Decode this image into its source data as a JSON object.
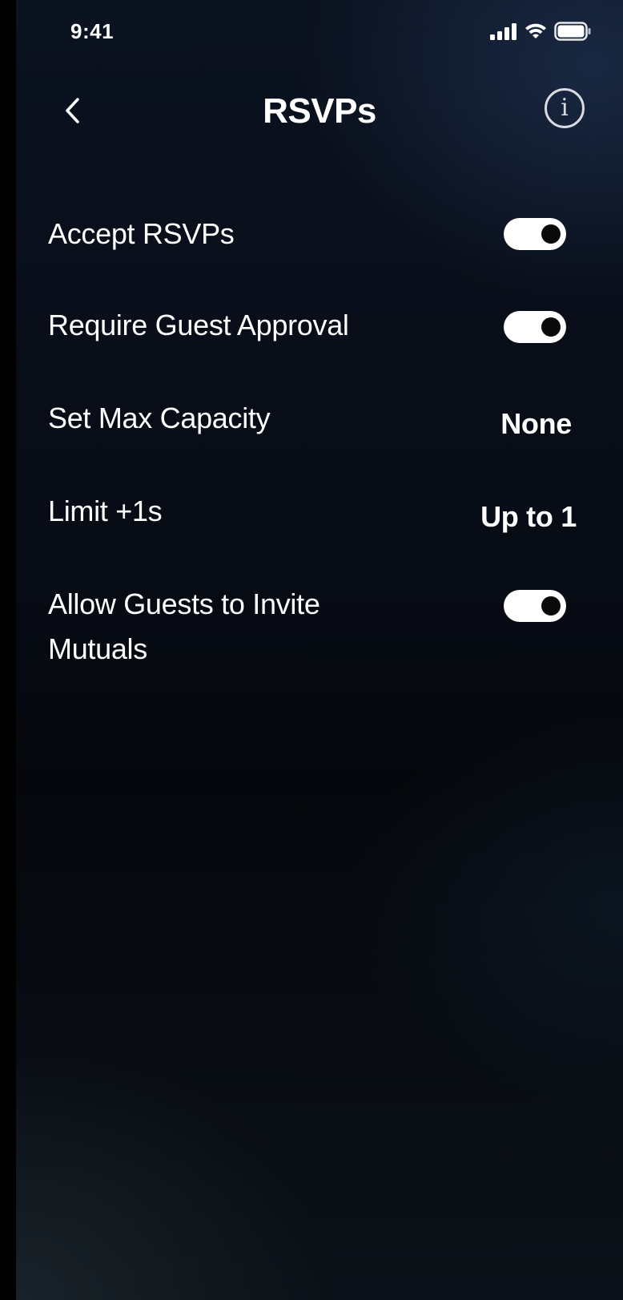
{
  "status_bar": {
    "time": "9:41",
    "icons": [
      "cellular-signal-icon",
      "wifi-icon",
      "battery-icon"
    ]
  },
  "header": {
    "title": "RSVPs",
    "back_icon": "chevron-left-icon",
    "info_icon": "info-icon",
    "info_glyph": "i"
  },
  "settings": {
    "accept_rsvps": {
      "label": "Accept RSVPs",
      "enabled": true
    },
    "require_guest_approval": {
      "label": "Require Guest Approval",
      "enabled": true
    },
    "max_capacity": {
      "label": "Set Max Capacity",
      "value": "None"
    },
    "limit_plus_ones": {
      "label": "Limit +1s",
      "value": "Up to 1"
    },
    "allow_guests_invite_mutuals": {
      "label_line1": "Allow Guests to Invite",
      "label_line2": "Mutuals",
      "enabled": true
    }
  },
  "colors": {
    "background_top": "#0b1220",
    "background_bottom": "#0b1118",
    "toggle_on": "#ffffff",
    "toggle_knob": "#0a0a0a",
    "text": "#ffffff"
  }
}
